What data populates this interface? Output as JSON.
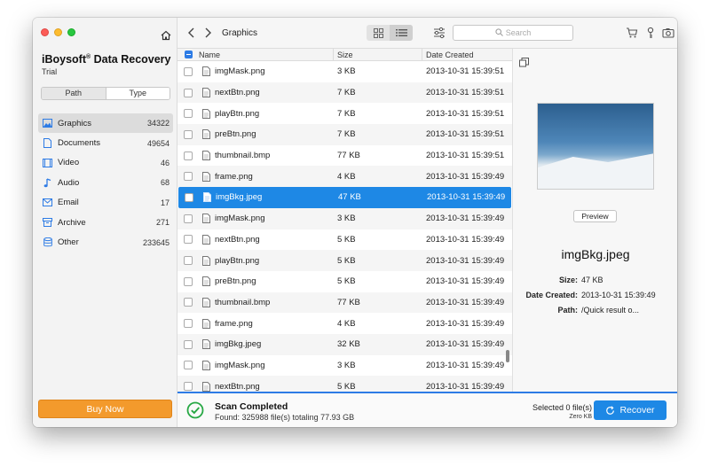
{
  "app": {
    "title": "iBoysoft",
    "title_reg": "®",
    "title_rest": " Data Recovery",
    "edition": "Trial"
  },
  "sidebar": {
    "segments": {
      "path": "Path",
      "type": "Type",
      "active": "type"
    },
    "categories": [
      {
        "label": "Graphics",
        "count": "34322",
        "icon": "image-icon",
        "active": true
      },
      {
        "label": "Documents",
        "count": "49654",
        "icon": "document-icon",
        "active": false
      },
      {
        "label": "Video",
        "count": "46",
        "icon": "film-icon",
        "active": false
      },
      {
        "label": "Audio",
        "count": "68",
        "icon": "music-note-icon",
        "active": false
      },
      {
        "label": "Email",
        "count": "17",
        "icon": "envelope-icon",
        "active": false
      },
      {
        "label": "Archive",
        "count": "271",
        "icon": "archive-icon",
        "active": false
      },
      {
        "label": "Other",
        "count": "233645",
        "icon": "database-icon",
        "active": false
      }
    ],
    "buy_label": "Buy Now"
  },
  "toolbar": {
    "breadcrumb": "Graphics",
    "search_placeholder": "Search",
    "view_mode": "list"
  },
  "file_list": {
    "headers": {
      "name": "Name",
      "size": "Size",
      "date": "Date Created"
    },
    "rows": [
      {
        "name": "imgMask.png",
        "size": "3 KB",
        "date": "2013-10-31 15:39:51",
        "selected": false
      },
      {
        "name": "nextBtn.png",
        "size": "7 KB",
        "date": "2013-10-31 15:39:51",
        "selected": false
      },
      {
        "name": "playBtn.png",
        "size": "7 KB",
        "date": "2013-10-31 15:39:51",
        "selected": false
      },
      {
        "name": "preBtn.png",
        "size": "7 KB",
        "date": "2013-10-31 15:39:51",
        "selected": false
      },
      {
        "name": "thumbnail.bmp",
        "size": "77 KB",
        "date": "2013-10-31 15:39:51",
        "selected": false
      },
      {
        "name": "frame.png",
        "size": "4 KB",
        "date": "2013-10-31 15:39:49",
        "selected": false
      },
      {
        "name": "imgBkg.jpeg",
        "size": "47 KB",
        "date": "2013-10-31 15:39:49",
        "selected": true
      },
      {
        "name": "imgMask.png",
        "size": "3 KB",
        "date": "2013-10-31 15:39:49",
        "selected": false
      },
      {
        "name": "nextBtn.png",
        "size": "5 KB",
        "date": "2013-10-31 15:39:49",
        "selected": false
      },
      {
        "name": "playBtn.png",
        "size": "5 KB",
        "date": "2013-10-31 15:39:49",
        "selected": false
      },
      {
        "name": "preBtn.png",
        "size": "5 KB",
        "date": "2013-10-31 15:39:49",
        "selected": false
      },
      {
        "name": "thumbnail.bmp",
        "size": "77 KB",
        "date": "2013-10-31 15:39:49",
        "selected": false
      },
      {
        "name": "frame.png",
        "size": "4 KB",
        "date": "2013-10-31 15:39:49",
        "selected": false
      },
      {
        "name": "imgBkg.jpeg",
        "size": "32 KB",
        "date": "2013-10-31 15:39:49",
        "selected": false
      },
      {
        "name": "imgMask.png",
        "size": "3 KB",
        "date": "2013-10-31 15:39:49",
        "selected": false
      },
      {
        "name": "nextBtn.png",
        "size": "5 KB",
        "date": "2013-10-31 15:39:49",
        "selected": false
      }
    ]
  },
  "preview": {
    "button_label": "Preview",
    "file_name": "imgBkg.jpeg",
    "size_label": "Size:",
    "size_value": "47 KB",
    "date_label": "Date Created:",
    "date_value": "2013-10-31 15:39:49",
    "path_label": "Path:",
    "path_value": "/Quick result o..."
  },
  "status": {
    "title": "Scan Completed",
    "summary": "Found: 325988 file(s) totaling 77.93 GB",
    "selected_count": "Selected 0 file(s)",
    "selected_size": "Zero KB",
    "recover_label": "Recover"
  },
  "colors": {
    "accent": "#1e88e5",
    "buy": "#f39a2c",
    "success": "#27a844"
  }
}
